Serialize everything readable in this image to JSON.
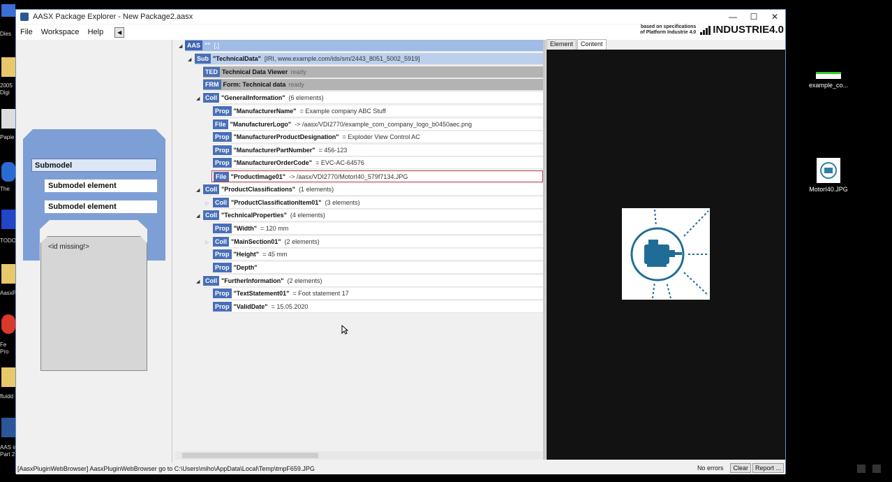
{
  "window": {
    "title": "AASX Package Explorer - New Package2.aasx",
    "minimize": "—",
    "maximize": "☐",
    "close": "✕"
  },
  "menu": {
    "file": "File",
    "workspace": "Workspace",
    "help": "Help",
    "collapse": "◀"
  },
  "brand": {
    "line1": "based on specifications",
    "line2": "of Platform Industrie 4.0",
    "logo": "INDUSTRIE4.0"
  },
  "submodel_view": {
    "title": "Submodel",
    "element1": "Submodel element",
    "element2": "Submodel element",
    "id_text": "<id missing!>"
  },
  "tree": {
    "aas": {
      "badge": "AAS",
      "name": "\"\"",
      "info": "[,]"
    },
    "sub": {
      "badge": "Sub",
      "name": "\"TechnicalData\"",
      "info": "[IRI, www.example.com/ids/sm/2443_8051_5002_5919]"
    },
    "ted": {
      "badge": "TED",
      "name": "Technical Data Viewer",
      "status": "ready"
    },
    "frm": {
      "badge": "FRM",
      "name": "Form: Technical data",
      "status": "ready"
    },
    "rows": [
      {
        "badge": "Coll",
        "name": "\"GeneralInformation\"",
        "info": "(6 elements)"
      },
      {
        "badge": "Prop",
        "name": "\"ManufacturerName\"",
        "info": "= Example company ABC Stuff"
      },
      {
        "badge": "File",
        "name": "\"ManufacturerLogo\"",
        "info": "-> /aasx/VDI2770/example_com_company_logo_b0450aec.png"
      },
      {
        "badge": "Prop",
        "name": "\"ManufacturerProductDesignation\"",
        "info": "= Exploder View Control AC"
      },
      {
        "badge": "Prop",
        "name": "\"ManufacturerPartNumber\"",
        "info": "= 456-123"
      },
      {
        "badge": "Prop",
        "name": "\"ManufacturerOrderCode\"",
        "info": "= EVC-AC-64576"
      },
      {
        "badge": "File",
        "name": "\"ProductImage01\"",
        "info": "-> /aasx/VDI2770/MotorI40_579f7134.JPG"
      },
      {
        "badge": "Coll",
        "name": "\"ProductClassifications\"",
        "info": "(1 elements)"
      },
      {
        "badge": "Coll",
        "name": "\"ProductClassificationItem01\"",
        "info": "(3 elements)"
      },
      {
        "badge": "Coll",
        "name": "\"TechnicalProperties\"",
        "info": "(4 elements)"
      },
      {
        "badge": "Prop",
        "name": "\"Width\"",
        "info": "= 120 mm"
      },
      {
        "badge": "Coll",
        "name": "\"MainSection01\"",
        "info": "(2 elements)"
      },
      {
        "badge": "Prop",
        "name": "\"Height\"",
        "info": "= 45 mm"
      },
      {
        "badge": "Prop",
        "name": "\"Depth\"",
        "info": ""
      },
      {
        "badge": "Coll",
        "name": "\"FurtherInformation\"",
        "info": "(2 elements)"
      },
      {
        "badge": "Prop",
        "name": "\"TextStatement01\"",
        "info": "= Foot statement 17"
      },
      {
        "badge": "Prop",
        "name": "\"ValidDate\"",
        "info": "= 15.05.2020"
      }
    ]
  },
  "tabs": {
    "element": "Element",
    "content": "Content"
  },
  "status": {
    "message": "[AasxPluginWebBrowser] AasxPluginWebBrowser go to C:\\Users\\miho\\AppData\\Local\\Temp\\tmpF659.JPG",
    "no_errors": "No errors",
    "clear": "Clear",
    "report": "Report ..."
  },
  "desktop": {
    "left_labels": [
      "Dies",
      "2005",
      "Digi",
      "Papie",
      "The",
      "TODO",
      "AasxP",
      "Fe",
      "Pro",
      "fluidd",
      "AAS in",
      "Part 2"
    ],
    "right_icons": [
      "example_co...",
      "MotorI40.JPG"
    ]
  }
}
